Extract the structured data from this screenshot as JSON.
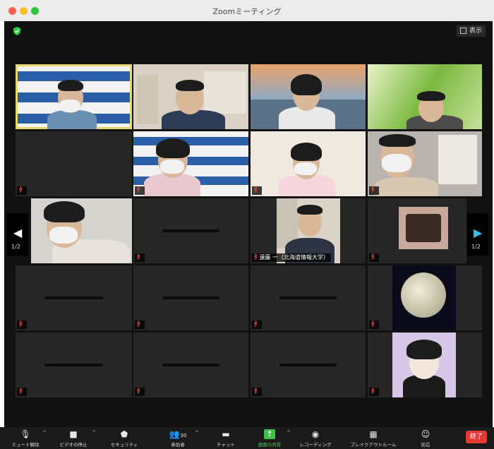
{
  "window": {
    "title": "Zoomミーティング"
  },
  "topbar": {
    "view_label": "表示"
  },
  "pager": {
    "left_label": "1/2",
    "right_label": "1/2"
  },
  "participants": {
    "named_label": "遠藤 一（北海道情報大学）"
  },
  "toolbar": {
    "mute_label": "ミュート解除",
    "video_label": "ビデオの停止",
    "security_label": "セキュリティ",
    "participants_label": "参加者",
    "participants_count": "30",
    "chat_label": "チャット",
    "share_label": "画面の共有",
    "record_label": "レコーディング",
    "breakout_label": "ブレイクアウトルーム",
    "reactions_label": "反応",
    "end_label": "終了"
  },
  "colors": {
    "end": "#e53935",
    "share": "#3ec14b",
    "active_speaker": "#e8d76e",
    "muted_icon": "#ff4040"
  }
}
